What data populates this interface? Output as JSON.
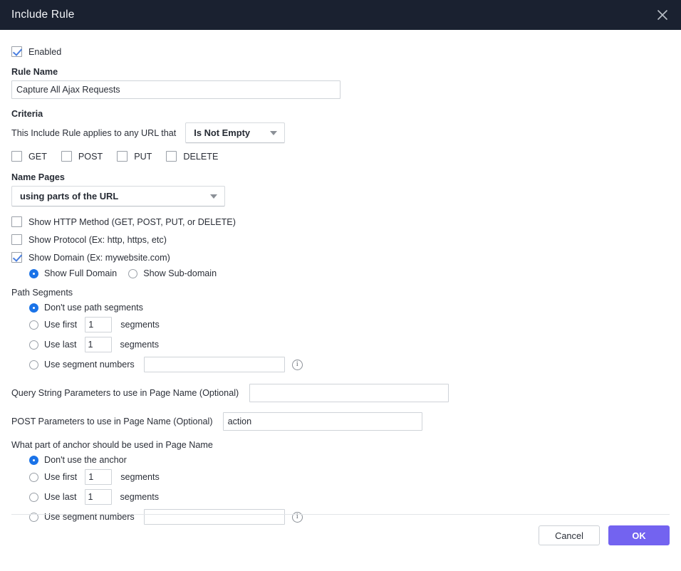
{
  "window": {
    "title": "Include Rule",
    "close_icon": "close-icon"
  },
  "enabled": {
    "label": "Enabled",
    "checked": true
  },
  "rule_name": {
    "label": "Rule Name",
    "value": "Capture All Ajax Requests"
  },
  "criteria": {
    "label": "Criteria",
    "description": "This Include Rule applies to any URL that",
    "condition_selected": "Is Not Empty",
    "methods": [
      {
        "label": "GET",
        "checked": false
      },
      {
        "label": "POST",
        "checked": false
      },
      {
        "label": "PUT",
        "checked": false
      },
      {
        "label": "DELETE",
        "checked": false
      }
    ]
  },
  "name_pages": {
    "label": "Name Pages",
    "selected": "using parts of the URL",
    "options": [
      {
        "label": "Show HTTP Method (GET, POST, PUT, or DELETE)",
        "checked": false
      },
      {
        "label": "Show Protocol (Ex: http, https, etc)",
        "checked": false
      },
      {
        "label": "Show Domain (Ex: mywebsite.com)",
        "checked": true
      }
    ],
    "domain_radios": [
      {
        "label": "Show Full Domain",
        "selected": true
      },
      {
        "label": "Show Sub-domain",
        "selected": false
      }
    ]
  },
  "path_segments": {
    "label": "Path Segments",
    "options": [
      {
        "label": "Don't use path segments",
        "selected": true
      },
      {
        "label": "Use first",
        "suffix": "segments",
        "value": "1",
        "selected": false
      },
      {
        "label": "Use last",
        "suffix": "segments",
        "value": "1",
        "selected": false
      },
      {
        "label": "Use segment numbers",
        "value": "",
        "selected": false,
        "info_icon": "info-icon"
      }
    ]
  },
  "query_string": {
    "label": "Query String Parameters to use in Page Name (Optional)",
    "value": ""
  },
  "post_params": {
    "label": "POST Parameters to use in Page Name (Optional)",
    "value": "action"
  },
  "anchor": {
    "label": "What part of anchor should be used in Page Name",
    "options": [
      {
        "label": "Don't use the anchor",
        "selected": true
      },
      {
        "label": "Use first",
        "suffix": "segments",
        "value": "1",
        "selected": false
      },
      {
        "label": "Use last",
        "suffix": "segments",
        "value": "1",
        "selected": false
      },
      {
        "label": "Use segment numbers",
        "value": "",
        "selected": false,
        "info_icon": "info-icon"
      }
    ]
  },
  "footer": {
    "cancel_label": "Cancel",
    "ok_label": "OK"
  },
  "colors": {
    "titlebar_bg": "#1a2130",
    "accent_primary": "#7363f0",
    "checkbox_check": "#4a7fe0",
    "radio_selected": "#1a73e8"
  }
}
